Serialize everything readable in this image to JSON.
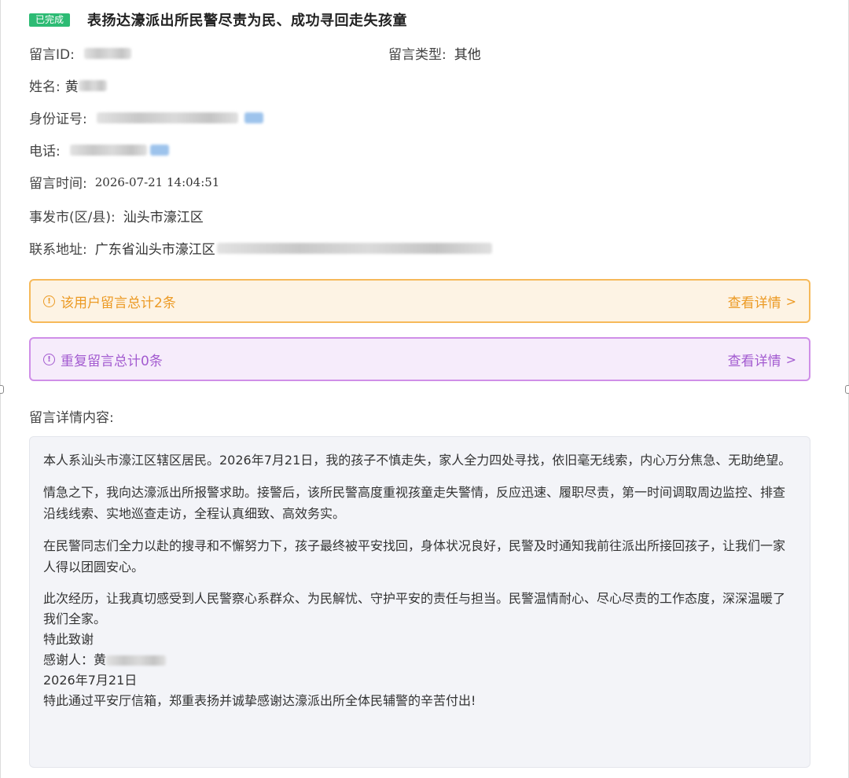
{
  "header": {
    "status_badge": "已完成",
    "title": "表扬达濠派出所民警尽责为民、成功寻回走失孩童"
  },
  "fields": {
    "message_id_label": "留言ID:",
    "message_type_label": "留言类型:",
    "message_type_value": "其他",
    "name_label": "姓名:",
    "name_value": "黄",
    "id_number_label": "身份证号:",
    "phone_label": "电话:",
    "time_label": "留言时间:",
    "time_value": "2026-07-21 14:04:51",
    "city_label": "事发市(区/县):",
    "city_value": "汕头市濠江区",
    "address_label": "联系地址:",
    "address_value": "广东省汕头市濠江区"
  },
  "alerts": {
    "user_total": "该用户留言总计2条",
    "user_total_link": "查看详情",
    "duplicate_total": "重复留言总计0条",
    "duplicate_total_link": "查看详情",
    "link_chevron": ">"
  },
  "content": {
    "section_title": "留言详情内容:",
    "paragraphs": [
      "本人系汕头市濠江区辖区居民。2026年7月21日，我的孩子不慎走失，家人全力四处寻找，依旧毫无线索，内心万分焦急、无助绝望。",
      "情急之下，我向达濠派出所报警求助。接警后，该所民警高度重视孩童走失警情，反应迅速、履职尽责，第一时间调取周边监控、排查沿线线索、实地巡查走访，全程认真细致、高效务实。",
      "在民警同志们全力以赴的搜寻和不懈努力下，孩子最终被平安找回，身体状况良好，民警及时通知我前往派出所接回孩子，让我们一家人得以团圆安心。",
      "此次经历，让我真切感受到人民警察心系群众、为民解忧、守护平安的责任与担当。民警温情耐心、尽心尽责的工作态度，深深温暖了我们全家。"
    ],
    "closing": "特此致谢",
    "signer": "感谢人：黄",
    "date": "2026年7月21日",
    "final": "特此通过平安厅信箱，郑重表扬并诚挚感谢达濠派出所全体民辅警的辛苦付出!"
  },
  "colors": {
    "badge_green": "#2dbb74",
    "alert_orange": "#ec9a24",
    "alert_purple": "#a35bd0",
    "content_bg": "#f3f4f8"
  },
  "icons": {
    "alert_icon": "info-circle-icon",
    "link_icon": "chevron-right-icon"
  }
}
